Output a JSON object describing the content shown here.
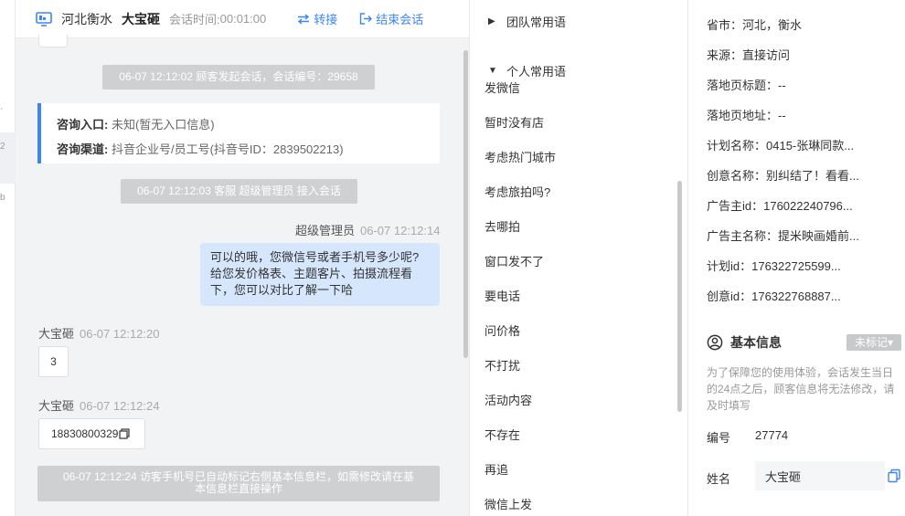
{
  "left_strip": {
    "glyphs": [
      "ˊ",
      "2",
      "b"
    ]
  },
  "header": {
    "location": "河北衡水",
    "customer_name": "大宝砸",
    "time_label": "会话时间:",
    "time_value": "00:01:00",
    "transfer_label": "转接",
    "end_label": "结束会话",
    "accent": "#3b86f5"
  },
  "chat": {
    "system_start": "06-07 12:12:02 顾客发起会话，会话编号：29658",
    "entry_label": "咨询入口:",
    "entry_value": "未知(暂无入口信息)",
    "channel_label": "咨询渠道:",
    "channel_value": "抖音企业号/员工号(抖音号ID：2839502213)",
    "system_join": "06-07 12:12:03 客服 超级管理员 接入会话",
    "agent_name": "超级管理员",
    "agent_time": "06-07 12:12:14",
    "agent_message_lines": [
      "可以的哦，您微信号或者手机号多少呢?",
      "给您发价格表、主题客片、拍摄流程看",
      "下，您可以对比了解一下哈"
    ],
    "msg1_sender": "大宝砸",
    "msg1_time": "06-07 12:12:20",
    "msg1_text": "3",
    "msg2_sender": "大宝砸",
    "msg2_time": "06-07 12:12:24",
    "msg2_text": "18830800329",
    "system_phone_lines": [
      "06-07 12:12:24 访客手机号已自动标记右侧基本信息栏，如需修改请在基",
      "本信息栏直接操作"
    ]
  },
  "phrases": {
    "team_group": "团队常用语",
    "personal_group": "个人常用语",
    "items": [
      "发微信",
      "暂时没有店",
      "考虑热门城市",
      "考虑旅拍吗?",
      "去哪拍",
      "窗口发不了",
      "要电话",
      "问价格",
      "不打扰",
      "活动内容",
      "不存在",
      "再追",
      "微信上发"
    ]
  },
  "info": {
    "rows": [
      "省市：河北，衡水",
      "来源：直接访问",
      "落地页标题：--",
      "落地页地址：--",
      "计划名称：0415-张琳同款...",
      "创意名称：别纠结了！看看...",
      "广告主id：176022240796...",
      "广告主名称：提米映画婚前...",
      "计划id：176322725599...",
      "创意id：176322768887..."
    ],
    "section_title": "基本信息",
    "tag_label": "未标记▾",
    "note": "为了保障您的使用体验，会话发生当日的24点之后，顾客信息将无法修改，请及时填写",
    "number_label": "编号",
    "number_value": "27774",
    "name_label": "姓名",
    "name_value": "大宝砸"
  }
}
